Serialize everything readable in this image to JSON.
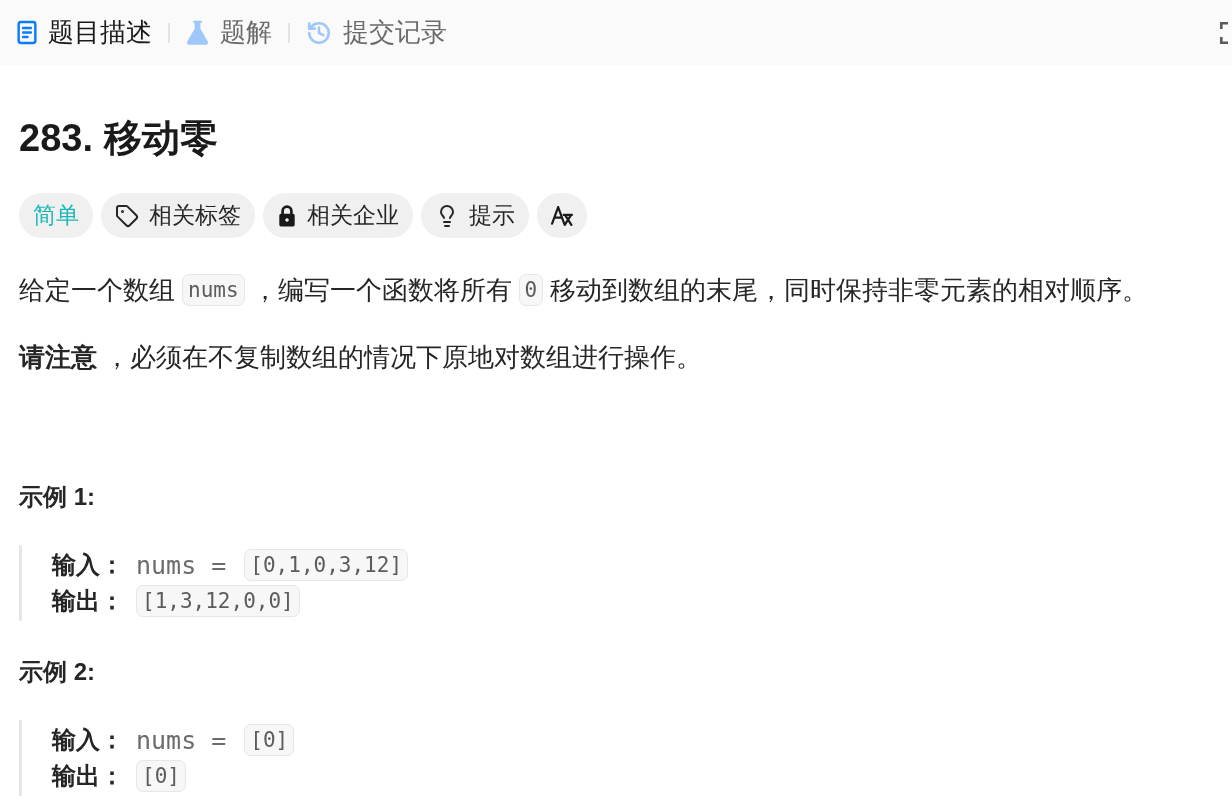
{
  "tabs": [
    {
      "kind": "description",
      "label": "题目描述",
      "selected": true
    },
    {
      "kind": "solution",
      "label": "题解",
      "selected": false
    },
    {
      "kind": "submissions",
      "label": "提交记录",
      "selected": false
    }
  ],
  "title": "283. 移动零",
  "tags": [
    {
      "kind": "difficulty",
      "label": "简单"
    },
    {
      "kind": "topics",
      "label": "相关标签"
    },
    {
      "kind": "companies",
      "label": "相关企业"
    },
    {
      "kind": "hint",
      "label": "提示"
    },
    {
      "kind": "translate"
    }
  ],
  "description": [
    {
      "segments": [
        {
          "kind": "text",
          "text": "给定一个数组"
        },
        {
          "kind": "code",
          "text": "nums"
        },
        {
          "kind": "text",
          "text": "，编写一个函数将所有"
        },
        {
          "kind": "code",
          "text": "0"
        },
        {
          "kind": "text",
          "text": "移动到数组的末尾，同时保持非零元素的相对顺序。"
        }
      ]
    },
    {
      "segments": [
        {
          "kind": "text",
          "text": "**请注意** ，必须在不复制数组的情况下原地对数组进行操作。"
        }
      ]
    }
  ],
  "examples": [
    {
      "title": "示例 1:",
      "lines": [
        {
          "label": "输入：",
          "text": "nums =",
          "code": "[0,1,0,3,12]"
        },
        {
          "label": "输出：",
          "code": "[1,3,12,0,0]"
        }
      ]
    },
    {
      "title": "示例 2:",
      "lines": [
        {
          "label": "输入：",
          "text": "nums =",
          "code": "[0]"
        },
        {
          "label": "输出：",
          "code": "[0]"
        }
      ]
    }
  ]
}
